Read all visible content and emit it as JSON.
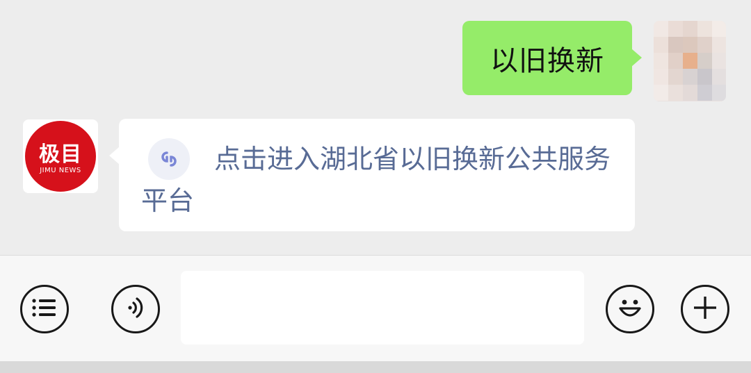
{
  "conversation": {
    "outgoing_message": "以旧换新",
    "incoming_link": "点击进入湖北省以旧换新公共服务平台"
  },
  "avatars": {
    "self": "pixelated-user-avatar",
    "jimu": {
      "logo_main": "极目",
      "logo_sub": "JIMU NEWS",
      "brand_color": "#d6111b"
    }
  },
  "input_bar": {
    "input_value": "",
    "icons": [
      "list-icon",
      "voice-icon",
      "emoji-icon",
      "plus-icon"
    ]
  },
  "colors": {
    "outgoing_bubble": "#95ec69",
    "incoming_bubble": "#ffffff",
    "link_text": "#586b95",
    "chat_background": "#ededed"
  }
}
